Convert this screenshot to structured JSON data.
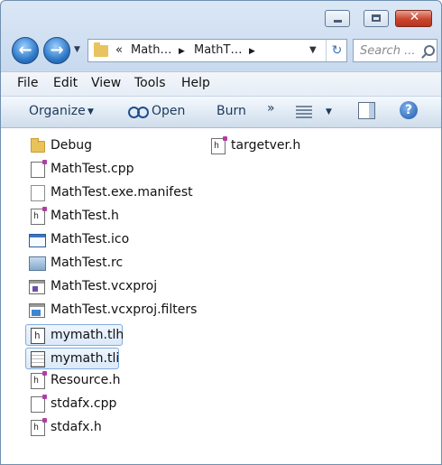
{
  "window": {
    "controls": {
      "minimize": "—",
      "maximize": "☐",
      "close": "✕"
    }
  },
  "navigation": {
    "back_glyph": "←",
    "forward_glyph": "→",
    "dropdown_glyph": "▼",
    "address": {
      "overflow": "«",
      "crumb1": "Math…",
      "sep1": "▶",
      "crumb2": "MathT…",
      "sep2": "▶",
      "dropdown": "▼",
      "refresh": "↻"
    },
    "search": {
      "placeholder": "Search ..."
    }
  },
  "menubar": {
    "items": [
      {
        "label": "File"
      },
      {
        "label": "Edit"
      },
      {
        "label": "View"
      },
      {
        "label": "Tools"
      },
      {
        "label": "Help"
      }
    ]
  },
  "toolbar": {
    "organize": "Organize",
    "caret": "▼",
    "open": "Open",
    "burn": "Burn",
    "more": "»",
    "help": "?"
  },
  "files": [
    {
      "name": "Debug",
      "icon": "folder-icon",
      "selected": false
    },
    {
      "name": "MathTest.cpp",
      "icon": "cpp-file-icon",
      "selected": false
    },
    {
      "name": "MathTest.exe.manifest",
      "icon": "blank-file-icon",
      "selected": false
    },
    {
      "name": "MathTest.h",
      "icon": "header-file-icon",
      "selected": false
    },
    {
      "name": "MathTest.ico",
      "icon": "ico-file-icon",
      "selected": false
    },
    {
      "name": "MathTest.rc",
      "icon": "resource-script-icon",
      "selected": false
    },
    {
      "name": "MathTest.vcxproj",
      "icon": "vcxproj-file-icon",
      "selected": false
    },
    {
      "name": "MathTest.vcxproj.filters",
      "icon": "filters-file-icon",
      "selected": false
    },
    {
      "name": "mymath.tlh",
      "icon": "tlh-file-icon",
      "selected": true
    },
    {
      "name": "mymath.tli",
      "icon": "tli-file-icon",
      "selected": true
    },
    {
      "name": "Resource.h",
      "icon": "header-file-icon",
      "selected": false
    },
    {
      "name": "stdafx.cpp",
      "icon": "cpp-file-icon",
      "selected": false
    },
    {
      "name": "stdafx.h",
      "icon": "header-file-icon",
      "selected": false
    },
    {
      "name": "targetver.h",
      "icon": "header-file-icon",
      "selected": false
    }
  ]
}
